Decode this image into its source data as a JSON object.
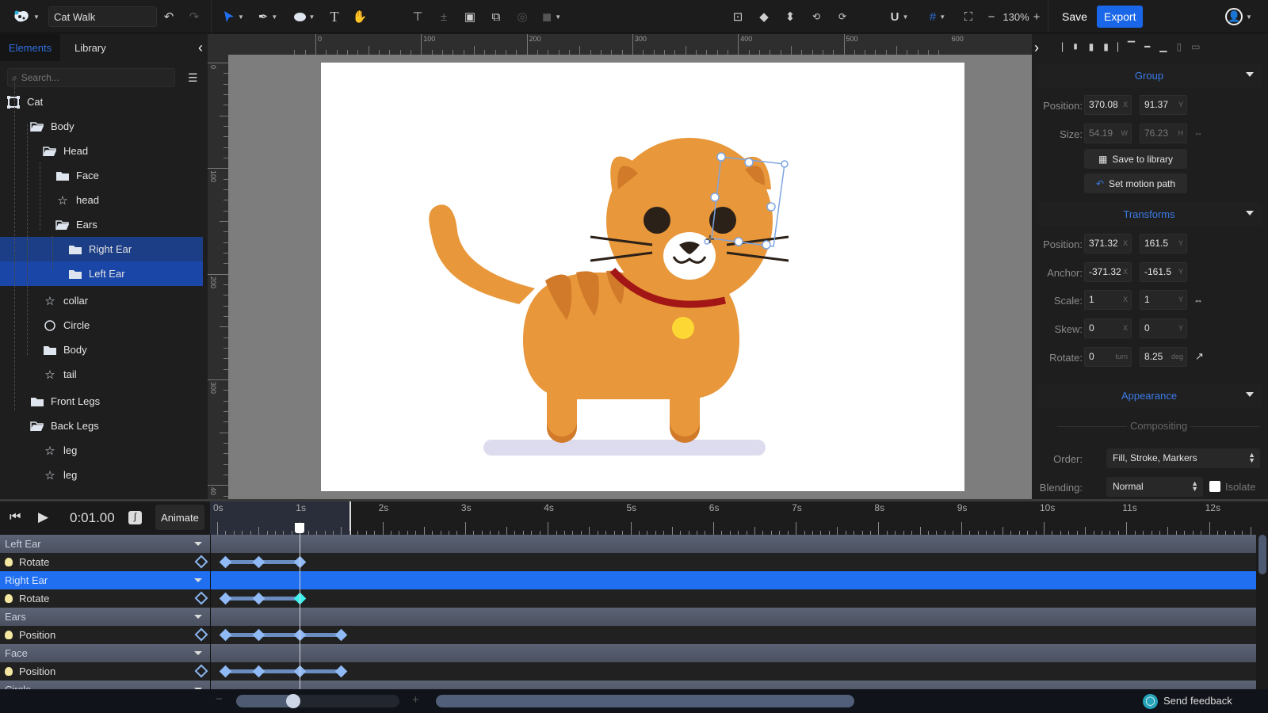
{
  "toolbar": {
    "app_icon": "app-logo-icon",
    "document_title": "Cat Walk",
    "tools": [
      "select-tool",
      "pen-tool",
      "ellipse-tool",
      "text-tool",
      "hand-tool"
    ],
    "zoom_level": "130%",
    "zoom_minus": "−",
    "zoom_plus": "+",
    "save_label": "Save",
    "export_label": "Export",
    "accent_color": "#1a66e8"
  },
  "left_panel": {
    "tabs": [
      {
        "label": "Elements",
        "active": true
      },
      {
        "label": "Library",
        "active": false
      }
    ],
    "collapse_icon": "‹",
    "search_placeholder": "Search...",
    "tree": [
      {
        "label": "Cat",
        "icon": "artboard-icon",
        "depth": 0
      },
      {
        "label": "Body",
        "icon": "folder-open-icon",
        "depth": 1
      },
      {
        "label": "Head",
        "icon": "folder-open-icon",
        "depth": 2
      },
      {
        "label": "Face",
        "icon": "folder-icon",
        "depth": 3
      },
      {
        "label": "head",
        "icon": "shape-icon",
        "depth": 3
      },
      {
        "label": "Ears",
        "icon": "folder-open-icon",
        "depth": 3
      },
      {
        "label": "Right Ear",
        "icon": "folder-icon",
        "depth": 4,
        "selected": true
      },
      {
        "label": "Left Ear",
        "icon": "folder-icon",
        "depth": 4,
        "selected": true
      },
      {
        "label": "collar",
        "icon": "shape-icon",
        "depth": 2
      },
      {
        "label": "Circle",
        "icon": "circle-icon",
        "depth": 2
      },
      {
        "label": "Body",
        "icon": "folder-icon",
        "depth": 2
      },
      {
        "label": "tail",
        "icon": "shape-icon",
        "depth": 2
      },
      {
        "label": "Front Legs",
        "icon": "folder-icon",
        "depth": 1
      },
      {
        "label": "Back Legs",
        "icon": "folder-open-icon",
        "depth": 1
      },
      {
        "label": "leg",
        "icon": "shape-icon",
        "depth": 2
      },
      {
        "label": "leg",
        "icon": "shape-icon",
        "depth": 2
      }
    ]
  },
  "rulers": {
    "top": [
      "0",
      "100",
      "200",
      "300",
      "400",
      "500",
      "600"
    ],
    "left": [
      "0",
      "100",
      "200",
      "300",
      "40"
    ]
  },
  "right_panel": {
    "group": {
      "title": "Group",
      "position_label": "Position:",
      "position_x": "370.08",
      "position_y": "91.37",
      "size_label": "Size:",
      "size_w": "54.19",
      "size_h": "76.23",
      "save_to_library": "Save to library",
      "set_motion_path": "Set motion path"
    },
    "transforms": {
      "title": "Transforms",
      "position_label": "Position:",
      "position_x": "371.32",
      "position_y": "161.5",
      "anchor_label": "Anchor:",
      "anchor_x": "-371.32",
      "anchor_y": "-161.5",
      "scale_label": "Scale:",
      "scale_x": "1",
      "scale_y": "1",
      "skew_label": "Skew:",
      "skew_x": "0",
      "skew_y": "0",
      "rotate_label": "Rotate:",
      "rotate_turn": "0",
      "rotate_deg": "8.25"
    },
    "units": {
      "x": "X",
      "y": "Y",
      "w": "W",
      "h": "H",
      "turn": "turn",
      "deg": "deg"
    },
    "appearance": {
      "title": "Appearance",
      "compositing": "Compositing",
      "order_label": "Order:",
      "order_value": "Fill, Stroke, Markers",
      "blending_label": "Blending:",
      "blending_value": "Normal",
      "isolate_label": "Isolate",
      "isolate_checked": false
    }
  },
  "timeline": {
    "time": "0:01.00",
    "animate_label": "Animate",
    "time_labels": [
      "0s",
      "1s",
      "2s",
      "3s",
      "4s",
      "5s",
      "6s",
      "7s",
      "8s",
      "9s",
      "10s",
      "11s",
      "12s"
    ],
    "current_time_s": 1.0,
    "rows": [
      {
        "type": "group",
        "label": "Left Ear"
      },
      {
        "type": "property",
        "label": "Rotate",
        "keyframes_s": [
          0.1,
          0.5,
          1.0
        ]
      },
      {
        "type": "group",
        "label": "Right Ear",
        "active": true
      },
      {
        "type": "property",
        "label": "Rotate",
        "keyframes_s": [
          0.1,
          0.5,
          1.0
        ],
        "active_keyframe_s": 1.0
      },
      {
        "type": "group",
        "label": "Ears"
      },
      {
        "type": "property",
        "label": "Position",
        "keyframes_s": [
          0.1,
          0.5,
          1.0,
          1.5
        ]
      },
      {
        "type": "group",
        "label": "Face"
      },
      {
        "type": "property",
        "label": "Position",
        "keyframes_s": [
          0.1,
          0.5,
          1.0,
          1.5
        ]
      },
      {
        "type": "group",
        "label": "Circle"
      }
    ],
    "zoom_slider_value": 0.35,
    "zoom_minus": "−",
    "zoom_plus": "+"
  },
  "footer": {
    "feedback_label": "Send feedback"
  }
}
